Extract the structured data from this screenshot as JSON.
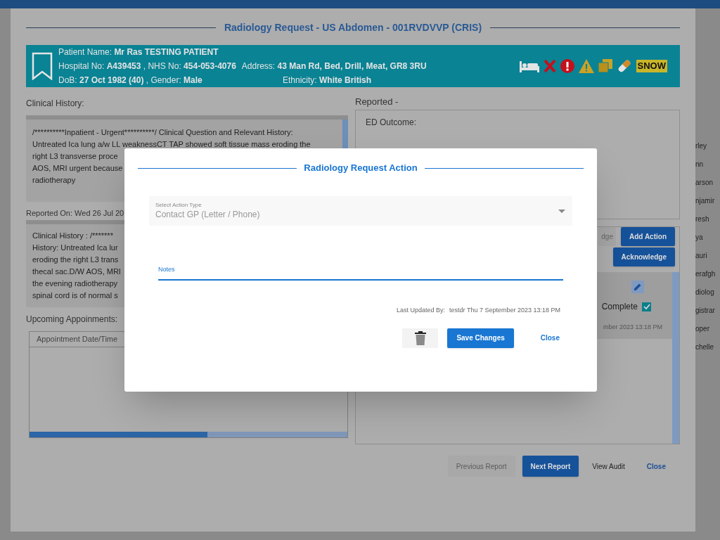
{
  "background_list": {
    "fragments": [
      "rley",
      "nn",
      "arson",
      "njamir",
      "resh",
      "ya",
      "auri",
      "erafgh",
      "diolog",
      "gistrar",
      "oper",
      "chelle"
    ]
  },
  "request_dialog": {
    "title": "Radiology Request - US Abdomen - 001RVDVVP (CRIS)",
    "patient_banner": {
      "name_line": "Patient Name: **Mr Ras TESTING PATIENT**",
      "ids_line": "Hospital No: **A439453** , NHS No: **454-053-4076**",
      "address_line": "Address: **43 Man Rd, Bed, Drill, Meat, GR8 3RU**",
      "dob_line": "DoB: **27 Oct 1982 (40)** , Gender: **Male**",
      "ethnicity_line": "Ethnicity: **White British**",
      "alerts": [
        {
          "kind": "bed"
        },
        {
          "kind": "cross"
        },
        {
          "kind": "exclamation"
        },
        {
          "kind": "warning"
        },
        {
          "kind": "copies"
        },
        {
          "kind": "pill"
        },
        {
          "kind": "badge",
          "label": "SNOW"
        }
      ]
    },
    "clinical_history": {
      "label": "Clinical History:",
      "lines": [
        "/**********Inpatient - Urgent**********/ Clinical Question and Relevant History:",
        "Untreated Ica lung a/w LL weaknessCT TAP showed soft tissue mass eroding the",
        "right L3 transverse proce",
        "AOS, MRI urgent because",
        "radiotherapy"
      ]
    },
    "reported_on": "Reported On: Wed 26 Jul 20",
    "report_text": {
      "lines": [
        "Clinical History : /*******",
        "History: Untreated Ica lur",
        "eroding the right L3 trans",
        "thecal sac.D/W AOS, MRI",
        "the evening radiotherapy",
        "spinal cord is of normal s"
      ]
    },
    "appointments": {
      "label": "Upcoming Appoinments:",
      "columns": [
        "Appointment Date/Time"
      ]
    },
    "reported": "Reported -",
    "ed_outcome": "ED Outcome:",
    "actions": {
      "buttons": [
        {
          "label": "dge",
          "disabled": true
        },
        {
          "label": "Add Action",
          "disabled": false
        },
        {
          "label": "Acknowledge",
          "disabled": false
        }
      ],
      "entry": {
        "status": "Complete",
        "checked": true,
        "date": "mber 2023 13:18 PM"
      }
    },
    "footer_buttons": [
      {
        "label": "Previous Report",
        "kind": "primary",
        "disabled": true
      },
      {
        "label": "Next Report",
        "kind": "primary",
        "disabled": false
      },
      {
        "label": "View Audit",
        "kind": "plain",
        "disabled": false
      },
      {
        "label": "Close",
        "kind": "link",
        "disabled": false
      }
    ]
  },
  "action_dialog": {
    "title": "Radiology Request Action",
    "action_type": {
      "label": "Select Action Type",
      "value": "Contact GP (Letter / Phone)"
    },
    "notes": {
      "label": "Notes"
    },
    "last_updated_label": "Last Updated By:",
    "last_updated_value": "testdr Thu 7 September 2023 13:18 PM",
    "save": "Save Changes",
    "close": "Close"
  }
}
